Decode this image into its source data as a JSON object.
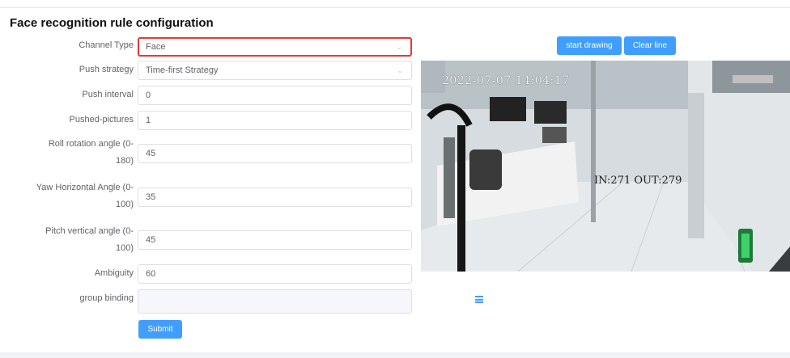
{
  "title": "Face recognition rule configuration",
  "form": {
    "channel_type": {
      "label": "Channel Type",
      "value": "Face"
    },
    "push_strategy": {
      "label": "Push strategy",
      "value": "Time-first Strategy"
    },
    "push_interval": {
      "label": "Push interval",
      "value": "0"
    },
    "pushed_pictures": {
      "label": "Pushed-pictures",
      "value": "1"
    },
    "roll_angle": {
      "label_line1": "Roll rotation angle (0-",
      "label_line2": "180)",
      "value": "45"
    },
    "yaw_angle": {
      "label_line1": "Yaw Horizontal Angle (0-",
      "label_line2": "100)",
      "value": "35"
    },
    "pitch_angle": {
      "label_line1": "Pitch vertical angle (0-",
      "label_line2": "100)",
      "value": "45"
    },
    "ambiguity": {
      "label": "Ambiguity",
      "value": "60"
    },
    "group_binding": {
      "label": "group binding",
      "value": ""
    },
    "submit_label": "Submit"
  },
  "toolbar": {
    "start_drawing_label": "start drawing",
    "clear_line_label": "Clear line"
  },
  "camera": {
    "timestamp": "2022-07-07 14:04:17",
    "counter": "IN:271 OUT:279"
  },
  "icons": {
    "select_chevron": "chevron-down-icon",
    "menu": "menu-icon"
  },
  "colors": {
    "primary": "#409eff",
    "active_border": "#e53935"
  }
}
